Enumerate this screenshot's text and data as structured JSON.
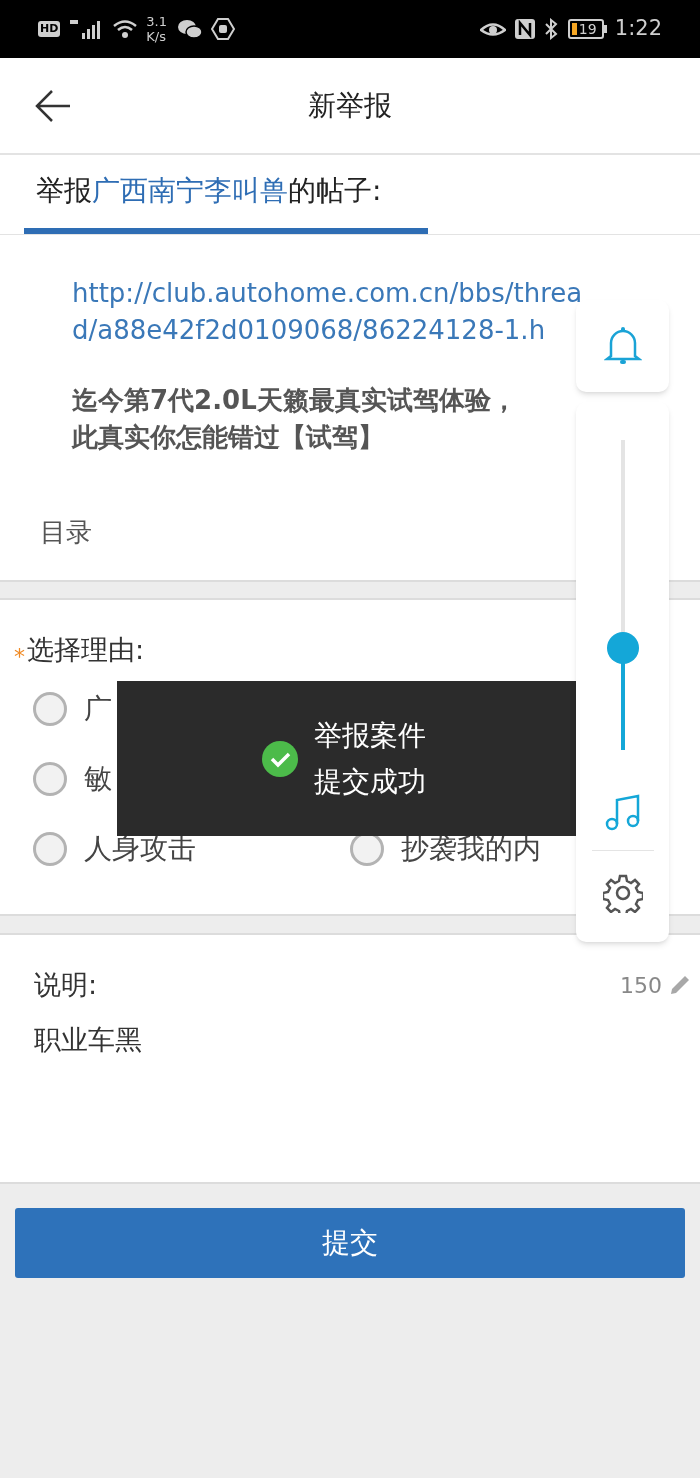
{
  "status_bar": {
    "hd_label": "HD",
    "speed": "3.1",
    "speed_unit": "K/s",
    "battery": "19",
    "time": "1:22"
  },
  "header": {
    "title": "新举报"
  },
  "tab": {
    "prefix": "举报",
    "user": "广西南宁李叫兽",
    "suffix": "的帖子:",
    "selected": true
  },
  "post": {
    "url_lines": [
      "http://club.autohome.com.cn/bbs/threa",
      "d/a88e42f2d0109068/86224128-1.h"
    ],
    "title_lines": [
      "迄今第7代2.0L天籁最真实试驾体验，",
      "此真实你怎能错过【试驾】"
    ],
    "section": "目录"
  },
  "reasons": {
    "required_mark": "*",
    "label": "选择理由:",
    "left_column": [
      {
        "label": "广",
        "selected": false
      },
      {
        "label": "敏",
        "selected": false
      },
      {
        "label": "人身攻击",
        "selected": false
      }
    ],
    "right_column": [
      {
        "label": "抄袭我的内",
        "selected": false
      }
    ]
  },
  "description": {
    "label": "说明:",
    "counter": "150",
    "value": "职业车黑"
  },
  "submit": {
    "label": "提交"
  },
  "toast": {
    "lines": [
      "举报案件",
      "提交成功"
    ]
  },
  "volume_panel": {
    "level": 0.33
  }
}
